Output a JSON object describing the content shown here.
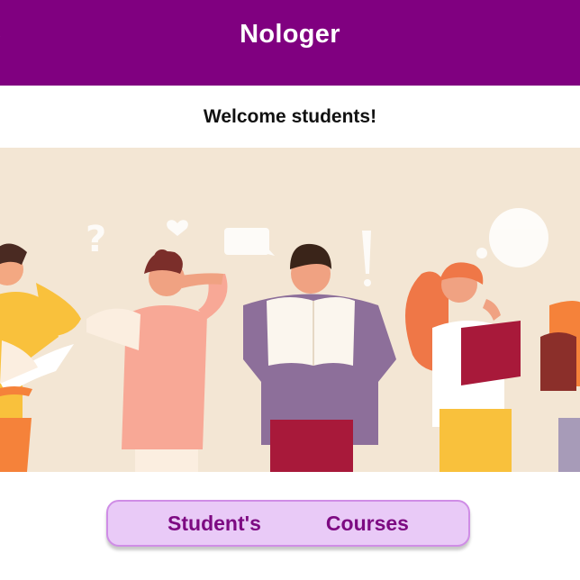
{
  "header": {
    "title": "Nologer",
    "back_icon": "back-arrow-icon",
    "background_color": "#800080"
  },
  "welcome": {
    "text": "Welcome students!"
  },
  "banner": {
    "image": "students-reading-illustration",
    "background_color": "#f3e6d4"
  },
  "nav": {
    "students_label": "Student's",
    "courses_label": "Courses",
    "accent_color": "#7d0a82",
    "bar_color": "#e9caf7"
  }
}
